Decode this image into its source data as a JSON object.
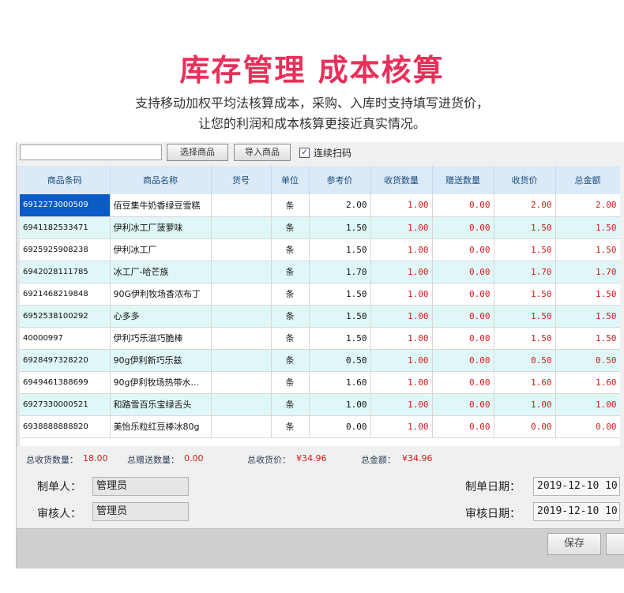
{
  "hero": {
    "title": "库存管理 成本核算",
    "sub_line1": "支持移动加权平均法核算成本，采购、入库时支持填写进货价，",
    "sub_line2": "让您的利润和成本核算更接近真实情况。"
  },
  "toolbar": {
    "select_product_label": "选择商品",
    "import_product_label": "导入商品",
    "continuous_scan_label": "连续扫码",
    "continuous_scan_checked": true
  },
  "table": {
    "columns": [
      "商品条码",
      "商品名称",
      "货号",
      "单位",
      "参考价",
      "收货数量",
      "赠送数量",
      "收货价",
      "总金额"
    ],
    "rows": [
      [
        "6912273000509",
        "佰豆集牛奶香绿豆雪糕",
        "",
        "条",
        "2.00",
        "1.00",
        "0.00",
        "2.00",
        "2.00"
      ],
      [
        "6941182533471",
        "伊利冰工厂菠萝味",
        "",
        "条",
        "1.50",
        "1.00",
        "0.00",
        "1.50",
        "1.50"
      ],
      [
        "6925925908238",
        "伊利冰工厂",
        "",
        "条",
        "1.50",
        "1.00",
        "0.00",
        "1.50",
        "1.50"
      ],
      [
        "6942028111785",
        "冰工厂-哈芒族",
        "",
        "条",
        "1.70",
        "1.00",
        "0.00",
        "1.70",
        "1.70"
      ],
      [
        "6921468219848",
        "90G伊利牧场香浓布丁",
        "",
        "条",
        "1.50",
        "1.00",
        "0.00",
        "1.50",
        "1.50"
      ],
      [
        "6952538100292",
        "心多多",
        "",
        "条",
        "1.50",
        "1.00",
        "0.00",
        "1.50",
        "1.50"
      ],
      [
        "40000997",
        "伊利巧乐滋巧脆棒",
        "",
        "条",
        "1.50",
        "1.00",
        "0.00",
        "1.50",
        "1.50"
      ],
      [
        "6928497328220",
        "90g伊利新巧乐兹",
        "",
        "条",
        "0.50",
        "1.00",
        "0.00",
        "0.50",
        "0.50"
      ],
      [
        "6949461388699",
        "90g伊利牧场热带水...",
        "",
        "条",
        "1.60",
        "1.00",
        "0.00",
        "1.60",
        "1.60"
      ],
      [
        "6927330000521",
        "和路雪百乐宝绿舌头",
        "",
        "条",
        "1.00",
        "1.00",
        "0.00",
        "1.00",
        "1.00"
      ],
      [
        "6938888888820",
        "美怡乐粒红豆棒冰80g",
        "",
        "条",
        "0.00",
        "1.00",
        "0.00",
        "0.00",
        "0.00"
      ]
    ]
  },
  "summary": {
    "total_qty_label": "总收货数量：",
    "total_qty_value": "18.00",
    "total_gift_label": "总赠送数量：",
    "total_gift_value": "0.00",
    "total_price_label": "总收货价：",
    "total_price_value": "¥34.96",
    "total_amount_label": "总金额：",
    "total_amount_value": "¥34.96"
  },
  "form": {
    "maker_label": "制单人：",
    "maker_value": "管理员",
    "reviewer_label": "审核人：",
    "reviewer_value": "管理员",
    "make_date_label": "制单日期：",
    "make_date_value": "2019-12-10 10",
    "review_date_label": "审核日期：",
    "review_date_value": "2019-12-10 10"
  },
  "actions": {
    "save_label": "保存"
  },
  "colors": {
    "hero_title": "#e8305a",
    "header_bg": "#dbeaf8",
    "alt_row": "#e0f7f7",
    "selected": "#0a5bc4",
    "value_red": "#d41b1b"
  }
}
